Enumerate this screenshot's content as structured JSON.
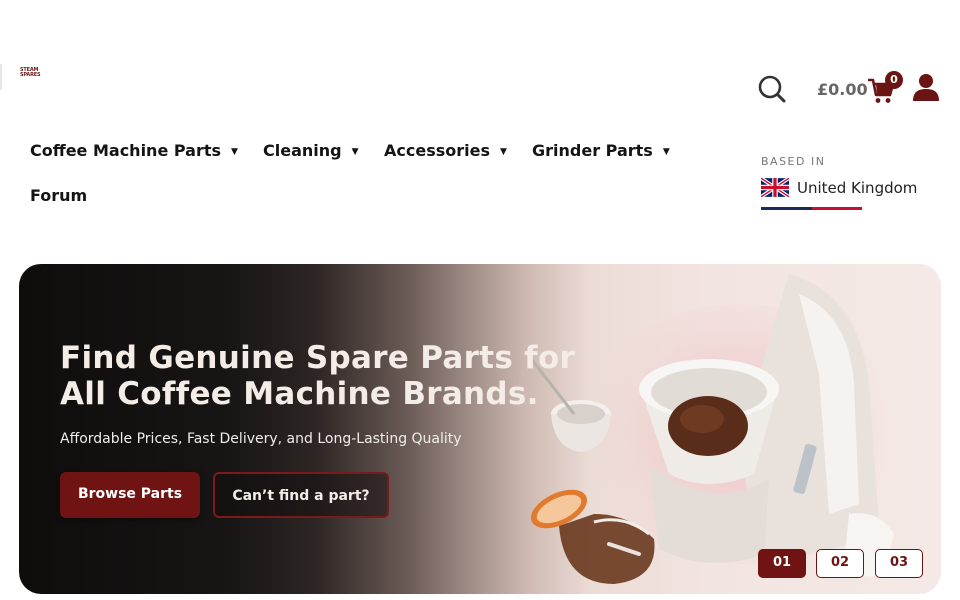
{
  "brand": {
    "logo_line1": "STEAM",
    "logo_line2": "SPARES"
  },
  "header": {
    "search_icon": "search-icon",
    "cart_total": "£0.00",
    "cart_icon": "cart-icon",
    "cart_count": "0",
    "account_icon": "user-icon"
  },
  "nav": {
    "items": [
      {
        "label": "Coffee Machine Parts",
        "has_dropdown": true
      },
      {
        "label": "Cleaning",
        "has_dropdown": true
      },
      {
        "label": "Accessories",
        "has_dropdown": true
      },
      {
        "label": "Grinder Parts",
        "has_dropdown": true
      },
      {
        "label": "Forum",
        "has_dropdown": false
      }
    ]
  },
  "location": {
    "label": "BASED IN",
    "country": "United Kingdom",
    "flag_icon": "uk-flag-icon"
  },
  "hero": {
    "title_line1": "Find Genuine Spare Parts for",
    "title_line2": "All Coffee Machine Brands.",
    "subtitle": "Affordable Prices, Fast Delivery, and Long-Lasting Quality",
    "primary_button": "Browse Parts",
    "secondary_button": "Can’t find a part?",
    "slides": [
      "01",
      "02",
      "03"
    ],
    "active_slide": "01"
  },
  "colors": {
    "accent": "#6f1313",
    "text_dark": "#141414",
    "muted": "#666666"
  }
}
